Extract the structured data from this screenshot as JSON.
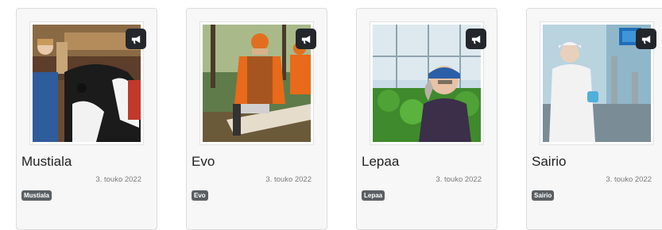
{
  "cards": [
    {
      "title": "Mustiala",
      "date": "3. touko 2022",
      "tag": "Mustiala",
      "photo": "cow-in-barn-photo"
    },
    {
      "title": "Evo",
      "date": "3. touko 2022",
      "tag": "Evo",
      "photo": "forestry-chainsaw-photo"
    },
    {
      "title": "Lepaa",
      "date": "3. touko 2022",
      "tag": "Lepaa",
      "photo": "greenhouse-gardener-photo"
    },
    {
      "title": "Sairio",
      "date": "3. touko 2022",
      "tag": "Sairio",
      "photo": "laboratory-worker-photo"
    }
  ],
  "icons": {
    "announce": "megaphone-icon"
  },
  "colors": {
    "card_bg": "#f7f7f8",
    "badge": "#5a5f63",
    "icon_bg": "#23272b"
  }
}
